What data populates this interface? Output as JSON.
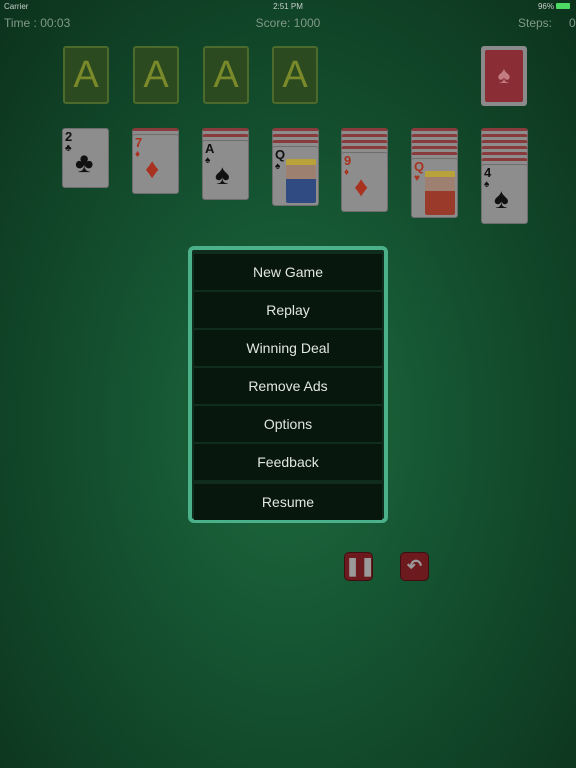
{
  "status_bar": {
    "carrier": "Carrier",
    "time": "2:51 PM",
    "battery": "96%"
  },
  "hud": {
    "time": "Time : 00:03",
    "score": "Score:  1000",
    "steps_label": "Steps:",
    "steps": "0"
  },
  "foundations": [
    "A",
    "A",
    "A",
    "A"
  ],
  "stock": {
    "icon": "card-back-spade-icon"
  },
  "tableau": [
    {
      "face_down": 0,
      "rank": "2",
      "suit": "♣",
      "color": "black"
    },
    {
      "face_down": 1,
      "rank": "7",
      "suit": "♦",
      "color": "red"
    },
    {
      "face_down": 2,
      "rank": "A",
      "suit": "♠",
      "color": "black"
    },
    {
      "face_down": 3,
      "rank": "Q",
      "suit": "♠",
      "color": "black"
    },
    {
      "face_down": 4,
      "rank": "9",
      "suit": "♦",
      "color": "red"
    },
    {
      "face_down": 5,
      "rank": "Q",
      "suit": "♥",
      "color": "red"
    },
    {
      "face_down": 6,
      "rank": "4",
      "suit": "♠",
      "color": "black"
    }
  ],
  "menu": {
    "items": [
      "New Game",
      "Replay",
      "Winning Deal",
      "Remove Ads",
      "Options",
      "Feedback",
      "Resume"
    ],
    "border_color": "#4bb18a"
  },
  "controls": {
    "pause_icon": "pause-icon",
    "undo_icon": "undo-icon"
  }
}
